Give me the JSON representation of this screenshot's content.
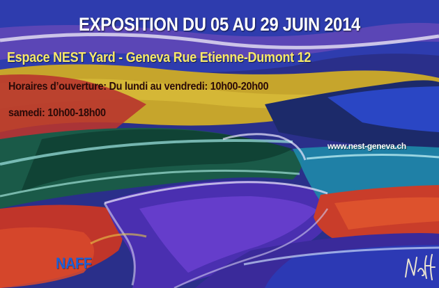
{
  "poster": {
    "title": "EXPOSITION DU 05 AU 29 JUIN 2014",
    "venue": "Espace NEST Yard - Geneva Rue Etienne-Dumont 12",
    "hours_line1": "Horaires d’ouverture: Du lundi au vendredi: 10h00-20h00",
    "hours_line2": "samedi: 10h00-18h00",
    "website": "www.nest-geneva.ch",
    "artist": "NAFF"
  },
  "colors": {
    "title": "#ffffff",
    "venue": "#f7e86a",
    "hours": "#2a0a08",
    "artist": "#1a5fd8"
  }
}
